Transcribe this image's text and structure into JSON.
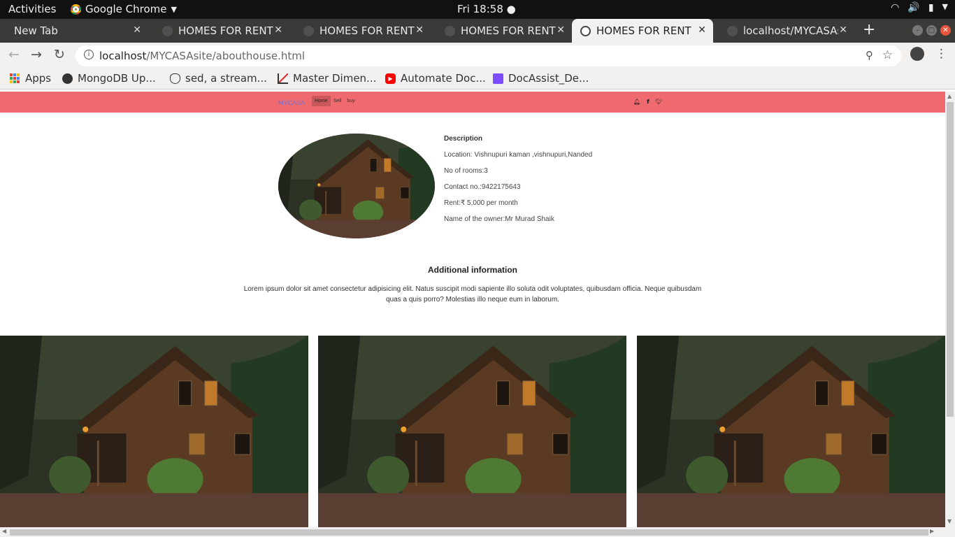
{
  "system_bar": {
    "activities": "Activities",
    "app_name": "Google Chrome",
    "clock": "Fri 18:58 ●"
  },
  "tabs": [
    {
      "label": "New Tab",
      "active": false
    },
    {
      "label": "HOMES FOR RENT",
      "active": false
    },
    {
      "label": "HOMES FOR RENT",
      "active": false
    },
    {
      "label": "HOMES FOR RENT",
      "active": false
    },
    {
      "label": "HOMES FOR RENT",
      "active": true
    },
    {
      "label": "localhost/MYCASAs",
      "active": false
    }
  ],
  "address_bar": {
    "host": "localhost",
    "path": "/MYCASAsite/abouthouse.html"
  },
  "bookmarks": [
    {
      "label": "Apps",
      "icon": "apps-grid-icon"
    },
    {
      "label": "MongoDB Up...",
      "icon": "globe-icon"
    },
    {
      "label": "sed, a stream...",
      "icon": "gnu-icon"
    },
    {
      "label": "Master Dimen...",
      "icon": "chart-icon"
    },
    {
      "label": "Automate Doc...",
      "icon": "youtube-icon"
    },
    {
      "label": "DocAssist_De...",
      "icon": "doc-icon"
    }
  ],
  "site": {
    "brand": "MYCASA",
    "nav": [
      "Home",
      "Sell",
      "buy"
    ],
    "social_icons": [
      "bell-icon",
      "facebook-icon",
      "twitter-icon"
    ],
    "colors": {
      "navbar": "#ee6a6e",
      "brand": "#7b6ec9",
      "active_link": "#c9585c"
    }
  },
  "description": {
    "title": "Description",
    "location": "Location: Vishnupuri kaman ,vishnupuri,Nanded",
    "rooms": "No of rooms:3",
    "contact": "Contact no.:9422175643",
    "rent": "Rent:₹ 5,000 per month",
    "owner": "Name of the owner:Mr Murad Shaik"
  },
  "additional": {
    "heading": "Additional information",
    "text": "Lorem ipsum dolor sit amet consectetur adipisicing elit. Natus suscipit modi sapiente illo soluta odit voluptates, quibusdam officia. Neque quibusdam quas a quis porro? Molestias illo neque eum in laborum."
  }
}
